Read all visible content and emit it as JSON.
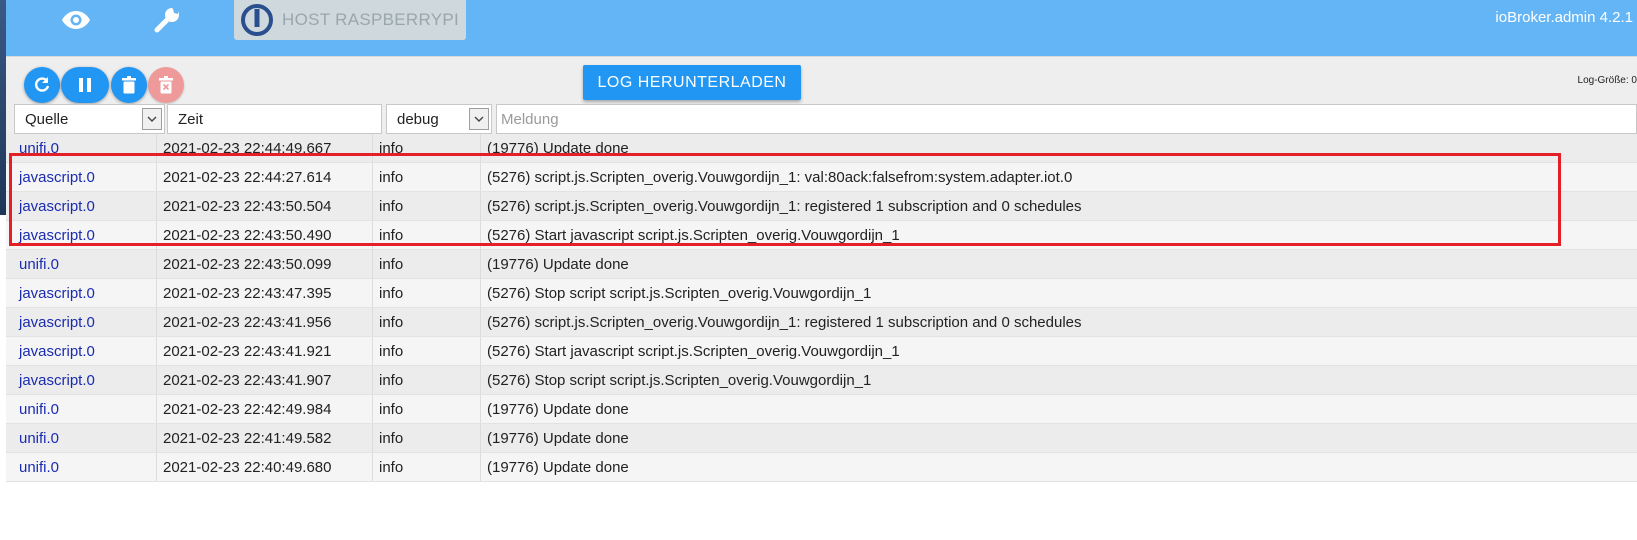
{
  "app": {
    "version": "ioBroker.admin 4.2.1"
  },
  "header": {
    "host_label": "HOST RASPBERRYPI",
    "icons": [
      "eye-icon",
      "wrench-icon"
    ]
  },
  "toolbar": {
    "refresh_icon": "refresh-icon",
    "pause_icon": "pause-icon",
    "delete_icon": "trash-icon",
    "delete_all_icon": "trash-x-icon",
    "download_label": "LOG HERUNTERLADEN",
    "log_size_label": "Log-Größe: 0"
  },
  "table": {
    "filters": {
      "source": "Quelle",
      "time": "Zeit",
      "level": "debug",
      "message_placeholder": "Meldung"
    },
    "rows": [
      {
        "source": "unifi.0",
        "time": "2021-02-23 22:44:49.667",
        "level": "info",
        "message": "(19776) Update done"
      },
      {
        "source": "javascript.0",
        "time": "2021-02-23 22:44:27.614",
        "level": "info",
        "message": "(5276) script.js.Scripten_overig.Vouwgordijn_1: val:80ack:falsefrom:system.adapter.iot.0"
      },
      {
        "source": "javascript.0",
        "time": "2021-02-23 22:43:50.504",
        "level": "info",
        "message": "(5276) script.js.Scripten_overig.Vouwgordijn_1: registered 1 subscription and 0 schedules"
      },
      {
        "source": "javascript.0",
        "time": "2021-02-23 22:43:50.490",
        "level": "info",
        "message": "(5276) Start javascript script.js.Scripten_overig.Vouwgordijn_1"
      },
      {
        "source": "unifi.0",
        "time": "2021-02-23 22:43:50.099",
        "level": "info",
        "message": "(19776) Update done"
      },
      {
        "source": "javascript.0",
        "time": "2021-02-23 22:43:47.395",
        "level": "info",
        "message": "(5276) Stop script script.js.Scripten_overig.Vouwgordijn_1"
      },
      {
        "source": "javascript.0",
        "time": "2021-02-23 22:43:41.956",
        "level": "info",
        "message": "(5276) script.js.Scripten_overig.Vouwgordijn_1: registered 1 subscription and 0 schedules"
      },
      {
        "source": "javascript.0",
        "time": "2021-02-23 22:43:41.921",
        "level": "info",
        "message": "(5276) Start javascript script.js.Scripten_overig.Vouwgordijn_1"
      },
      {
        "source": "javascript.0",
        "time": "2021-02-23 22:43:41.907",
        "level": "info",
        "message": "(5276) Stop script script.js.Scripten_overig.Vouwgordijn_1"
      },
      {
        "source": "unifi.0",
        "time": "2021-02-23 22:42:49.984",
        "level": "info",
        "message": "(19776) Update done"
      },
      {
        "source": "unifi.0",
        "time": "2021-02-23 22:41:49.582",
        "level": "info",
        "message": "(19776) Update done"
      },
      {
        "source": "unifi.0",
        "time": "2021-02-23 22:40:49.680",
        "level": "info",
        "message": "(19776) Update done"
      }
    ]
  },
  "colors": {
    "topbar": "#64b5f6",
    "button": "#2196f3",
    "button_disabled": "#ef9a9a",
    "source_text": "#1a2bb0",
    "highlight": "#e32028"
  }
}
